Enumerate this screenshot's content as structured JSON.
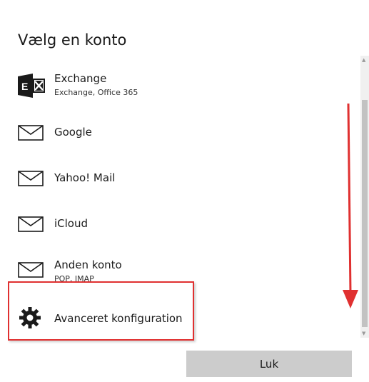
{
  "dialog": {
    "title": "Vælg en konto",
    "close_label": "Luk"
  },
  "accounts": [
    {
      "name": "Exchange",
      "subtitle": "Exchange, Office 365",
      "icon": "exchange-icon"
    },
    {
      "name": "Google",
      "icon": "mail-envelope-icon"
    },
    {
      "name": "Yahoo! Mail",
      "icon": "mail-envelope-icon"
    },
    {
      "name": "iCloud",
      "icon": "mail-envelope-icon"
    },
    {
      "name": "Anden konto",
      "subtitle": "POP, IMAP",
      "icon": "mail-envelope-icon"
    },
    {
      "name": "Avanceret konfiguration",
      "icon": "gear-icon"
    }
  ],
  "colors": {
    "annotation": "#e03030",
    "exchange_icon": "#1a1a1a",
    "button_bg": "#cccccc",
    "scrollbar_thumb": "#c2c2c2"
  }
}
